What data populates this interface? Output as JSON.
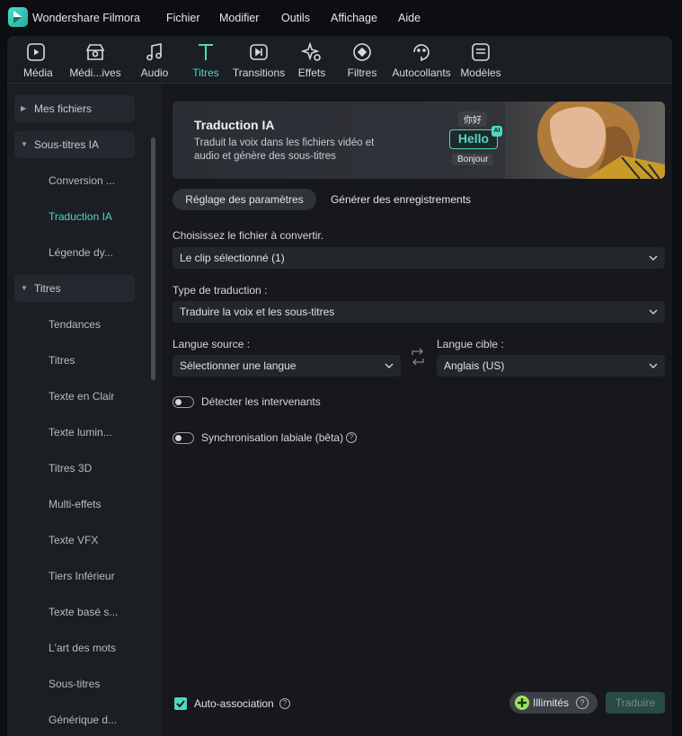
{
  "app": {
    "name": "Wondershare Filmora"
  },
  "menu": [
    "Fichier",
    "Modifier",
    "Outils",
    "Affichage",
    "Aide"
  ],
  "tabs": [
    {
      "label": "Média",
      "icon": "media-icon",
      "active": false
    },
    {
      "label": "Médi...ives",
      "icon": "stock-media-icon",
      "active": false
    },
    {
      "label": "Audio",
      "icon": "music-note-icon",
      "active": false
    },
    {
      "label": "Titres",
      "icon": "title-t-icon",
      "active": true
    },
    {
      "label": "Transitions",
      "icon": "transition-icon",
      "active": false
    },
    {
      "label": "Effets",
      "icon": "effects-sparkle-icon",
      "active": false
    },
    {
      "label": "Filtres",
      "icon": "filter-icon",
      "active": false
    },
    {
      "label": "Autocollants",
      "icon": "sticker-icon",
      "active": false
    },
    {
      "label": "Modèles",
      "icon": "template-icon",
      "active": false
    }
  ],
  "sidebar": {
    "groups": [
      {
        "label": "Mes fichiers",
        "expanded": false
      },
      {
        "label": "Sous-titres IA",
        "expanded": true
      },
      {
        "label": "Titres",
        "expanded": true
      }
    ],
    "subtitle_items": [
      "Conversion ...",
      "Traduction IA",
      "Légende dy..."
    ],
    "title_items": [
      "Tendances",
      "Titres",
      "Texte en Clair",
      "Texte lumin...",
      "Titres 3D",
      "Multi-effets",
      "Texte VFX",
      "Tiers Inférieur",
      "Texte basé s...",
      "L'art des mots",
      "Sous-titres",
      "Générique d..."
    ]
  },
  "banner": {
    "title": "Traduction IA",
    "description": "Traduit la voix dans les fichiers vidéo et audio et génère des sous-titres",
    "chips": [
      "你好",
      "Hello",
      "Bonjour"
    ],
    "ai_badge": "AI"
  },
  "subtabs": {
    "active": "Réglage des paramètres",
    "inactive": "Générer des enregistrements"
  },
  "form": {
    "file_label": "Choisissez le fichier à convertir.",
    "file_value": "Le clip sélectionné (1)",
    "type_label": "Type de traduction :",
    "type_value": "Traduire la voix et les sous-titres",
    "source_label": "Langue source :",
    "source_value": "Sélectionner une langue",
    "target_label": "Langue cible :",
    "target_value": "Anglais (US)",
    "detect_speakers": "Détecter les intervenants",
    "lip_sync": "Synchronisation labiale (bêta)"
  },
  "footer": {
    "auto_match": "Auto-association",
    "unlimited": "Illimités",
    "translate": "Traduire"
  },
  "colors": {
    "accent": "#4fd8c2",
    "panel": "#1b1e23",
    "content": "#16181c",
    "background": "#0d0e11"
  }
}
